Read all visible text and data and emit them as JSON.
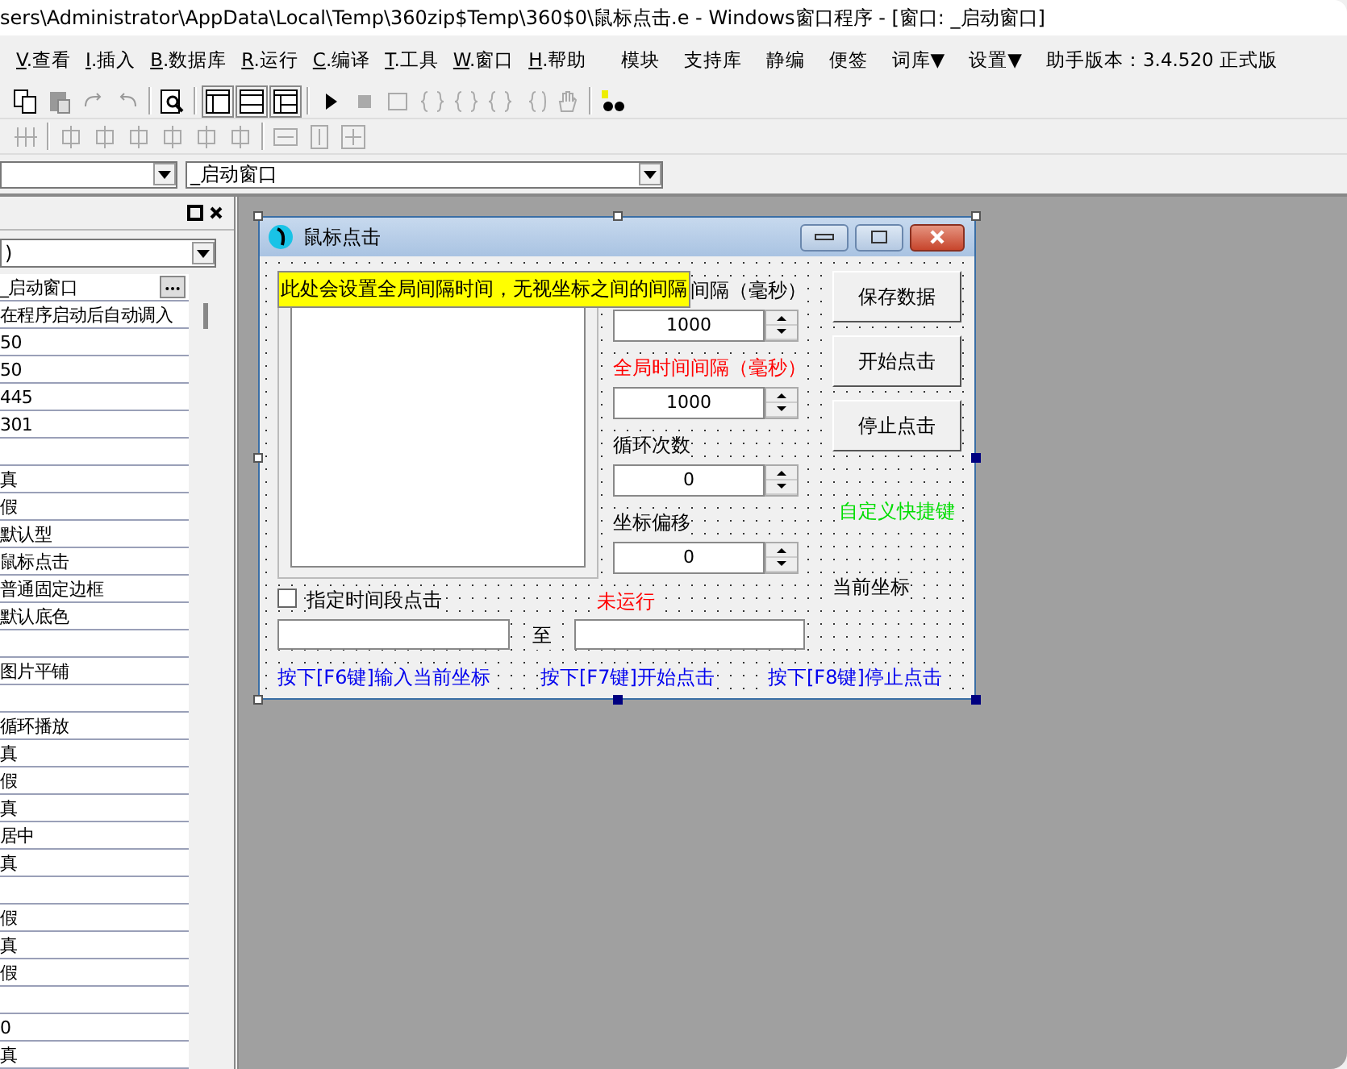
{
  "window": {
    "title": "sers\\Administrator\\AppData\\Local\\Temp\\360zip$Temp\\360$0\\鼠标点击.e - Windows窗口程序 - [窗口: _启动窗口]"
  },
  "menu": [
    {
      "key": "V",
      "label": ".查看"
    },
    {
      "key": "I",
      "label": ".插入"
    },
    {
      "key": "B",
      "label": ".数据库"
    },
    {
      "key": "R",
      "label": ".运行"
    },
    {
      "key": "C",
      "label": ".编译"
    },
    {
      "key": "T",
      "label": ".工具"
    },
    {
      "key": "W",
      "label": ".窗口"
    },
    {
      "key": "H",
      "label": ".帮助"
    },
    {
      "label": "模块"
    },
    {
      "label": "支持库"
    },
    {
      "label": "静编"
    },
    {
      "label": "便签"
    },
    {
      "label": "词库▼"
    },
    {
      "label": "设置▼"
    },
    {
      "label": "助手版本：3.4.520 正式版"
    }
  ],
  "window_combo": {
    "value": "_启动窗口"
  },
  "properties_panel": {
    "combo_value": ")",
    "rows": [
      {
        "kind": "picker",
        "value": "_启动窗口"
      },
      {
        "kind": "text",
        "value": "在程序启动后自动调入"
      },
      {
        "kind": "text",
        "value": "50"
      },
      {
        "kind": "text",
        "value": "50"
      },
      {
        "kind": "text",
        "value": "445"
      },
      {
        "kind": "text",
        "value": "301"
      },
      {
        "kind": "text"
      },
      {
        "kind": "text",
        "value": "真"
      },
      {
        "kind": "text",
        "value": "假"
      },
      {
        "kind": "text",
        "value": "默认型"
      },
      {
        "kind": "text",
        "value": "鼠标点击"
      },
      {
        "kind": "text",
        "value": "普通固定边框"
      },
      {
        "kind": "text",
        "value": "默认底色"
      },
      {
        "kind": "text"
      },
      {
        "kind": "text",
        "value": "图片平铺"
      },
      {
        "kind": "text"
      },
      {
        "kind": "text",
        "value": "循环播放"
      },
      {
        "kind": "text",
        "value": "真"
      },
      {
        "kind": "text",
        "value": "假"
      },
      {
        "kind": "text",
        "value": "真"
      },
      {
        "kind": "text",
        "value": "居中"
      },
      {
        "kind": "text",
        "value": "真"
      },
      {
        "kind": "text"
      },
      {
        "kind": "text",
        "value": "假"
      },
      {
        "kind": "text",
        "value": "真"
      },
      {
        "kind": "text",
        "value": "假"
      },
      {
        "kind": "text"
      },
      {
        "kind": "text",
        "value": "0"
      },
      {
        "kind": "text",
        "value": "真"
      }
    ]
  },
  "form": {
    "title": "鼠标点击",
    "tooltip": "此处会设置全局间隔时间，无视坐标之间的间隔",
    "spinners": [
      {
        "label": "间隔（毫秒）",
        "value": "1000",
        "color": "#000000"
      },
      {
        "label": "全局时间间隔（毫秒）",
        "value": "1000",
        "color": "#ff0000"
      },
      {
        "label": "循环次数",
        "value": "0",
        "color": "#000000"
      },
      {
        "label": "坐标偏移",
        "value": "0",
        "color": "#000000"
      }
    ],
    "buttons": [
      "保存数据",
      "开始点击",
      "停止点击"
    ],
    "hotkey_label": "自定义快捷键",
    "coords_label": "当前坐标",
    "checkbox": {
      "label": "指定时间段点击",
      "checked": false
    },
    "status": "未运行",
    "to_label": "至",
    "hints": [
      "按下[F6键]输入当前坐标",
      "按下[F7键]开始点击",
      "按下[F8键]停止点击"
    ]
  }
}
